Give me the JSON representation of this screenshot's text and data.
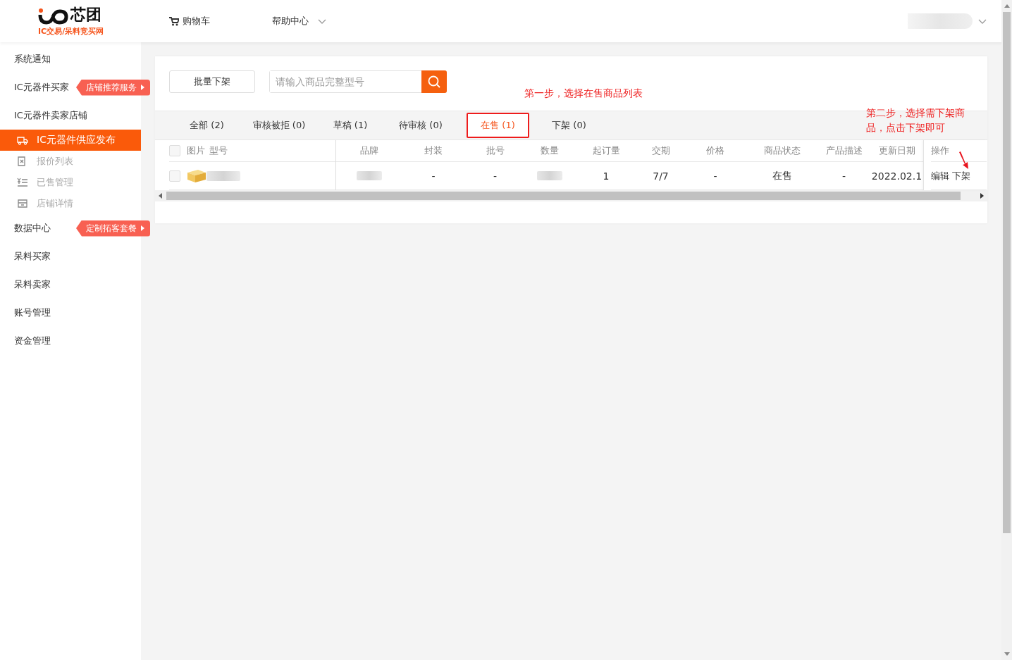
{
  "header": {
    "logo": {
      "name": "芯团",
      "tagline": "IC交易/呆料竞买网"
    },
    "nav": [
      {
        "label": "购物车",
        "kind": "cart"
      },
      {
        "label": "帮助中心",
        "kind": "dropdown"
      }
    ],
    "user": {
      "kind": "redacted"
    }
  },
  "sidebar": {
    "items": [
      {
        "label": "系统通知",
        "selected": false
      },
      {
        "label": "IC元器件买家",
        "selected": false,
        "badge": "店铺推荐服务"
      },
      {
        "label": "IC元器件卖家店铺",
        "selected": false,
        "children": [
          {
            "label": "IC元器件供应发布",
            "selected": true
          },
          {
            "label": "报价列表",
            "selected": false
          },
          {
            "label": "已售管理",
            "selected": false
          },
          {
            "label": "店铺详情",
            "selected": false
          }
        ]
      },
      {
        "label": "数据中心",
        "selected": false,
        "badge": "定制拓客套餐"
      },
      {
        "label": "呆料买家",
        "selected": false
      },
      {
        "label": "呆料卖家",
        "selected": false
      },
      {
        "label": "账号管理",
        "selected": false
      },
      {
        "label": "资金管理",
        "selected": false
      }
    ]
  },
  "toolbar": {
    "batch_button": "批量下架",
    "search": {
      "placeholder": "请输入商品完整型号"
    }
  },
  "annotations": [
    {
      "text": "第一步，选择在售商品列表"
    },
    {
      "text": "第二步，选择需下架商品，点击下架即可"
    }
  ],
  "tabs": [
    {
      "label": "全部 (2)",
      "selected": false
    },
    {
      "label": "审核被拒 (0)",
      "selected": false
    },
    {
      "label": "草稿 (1)",
      "selected": false
    },
    {
      "label": "待审核 (0)",
      "selected": false
    },
    {
      "label": "在售 (1)",
      "selected": true
    },
    {
      "label": "下架 (0)",
      "selected": false
    }
  ],
  "table": {
    "header_checked": false,
    "fixed_columns": [
      "图片",
      "型号"
    ],
    "columns": [
      "品牌",
      "封装",
      "批号",
      "数量",
      "起订量",
      "交期",
      "价格",
      "商品状态",
      "产品描述",
      "更新日期"
    ],
    "action_column": "操作",
    "rows": [
      {
        "checked": false,
        "model": {
          "kind": "redacted"
        },
        "cells": [
          {
            "kind": "redacted"
          },
          {
            "kind": "text",
            "text": "-"
          },
          {
            "kind": "text",
            "text": "-"
          },
          {
            "kind": "redacted"
          },
          {
            "kind": "text",
            "text": "1"
          },
          {
            "kind": "text",
            "text": "7/7"
          },
          {
            "kind": "text",
            "text": "-"
          },
          {
            "kind": "text",
            "text": "在售"
          },
          {
            "kind": "text",
            "text": "-"
          },
          {
            "kind": "text",
            "text": "2022.02.1"
          }
        ],
        "actions": [
          "编辑",
          "下架"
        ]
      }
    ]
  }
}
